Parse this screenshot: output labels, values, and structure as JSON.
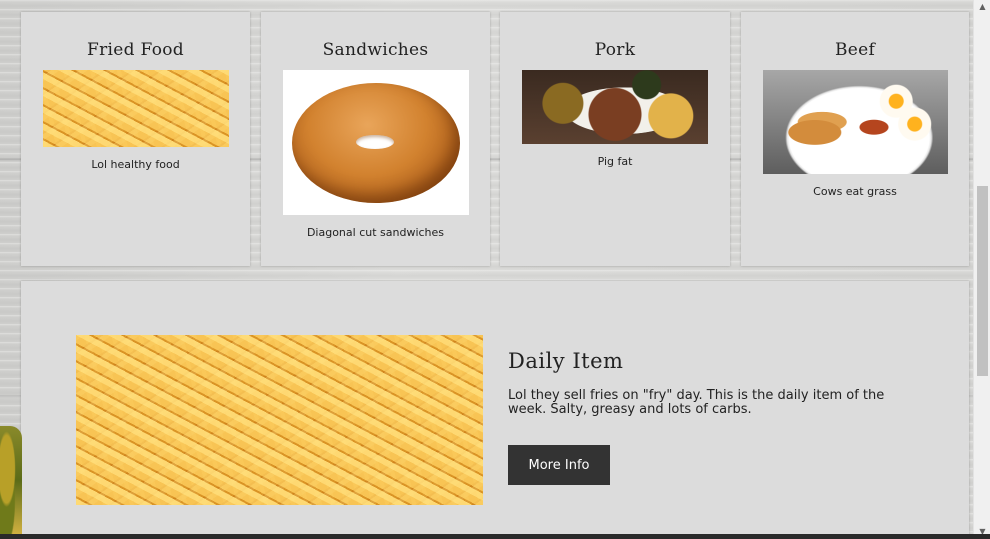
{
  "cards": [
    {
      "title": "Fried Food",
      "caption": "Lol healthy food"
    },
    {
      "title": "Sandwiches",
      "caption": "Diagonal cut sandwiches"
    },
    {
      "title": "Pork",
      "caption": "Pig fat"
    },
    {
      "title": "Beef",
      "caption": "Cows eat grass"
    }
  ],
  "daily": {
    "heading": "Daily Item",
    "text": "Lol they sell fries on \"fry\" day. This is the daily item of the week. Salty, greasy and lots of carbs.",
    "button_label": "More Info"
  },
  "icons": {
    "scroll_up": "scroll-up-arrow-icon",
    "scroll_down": "scroll-down-arrow-icon"
  },
  "scrollbar_glyphs": {
    "up": "▲",
    "down": "▼"
  }
}
